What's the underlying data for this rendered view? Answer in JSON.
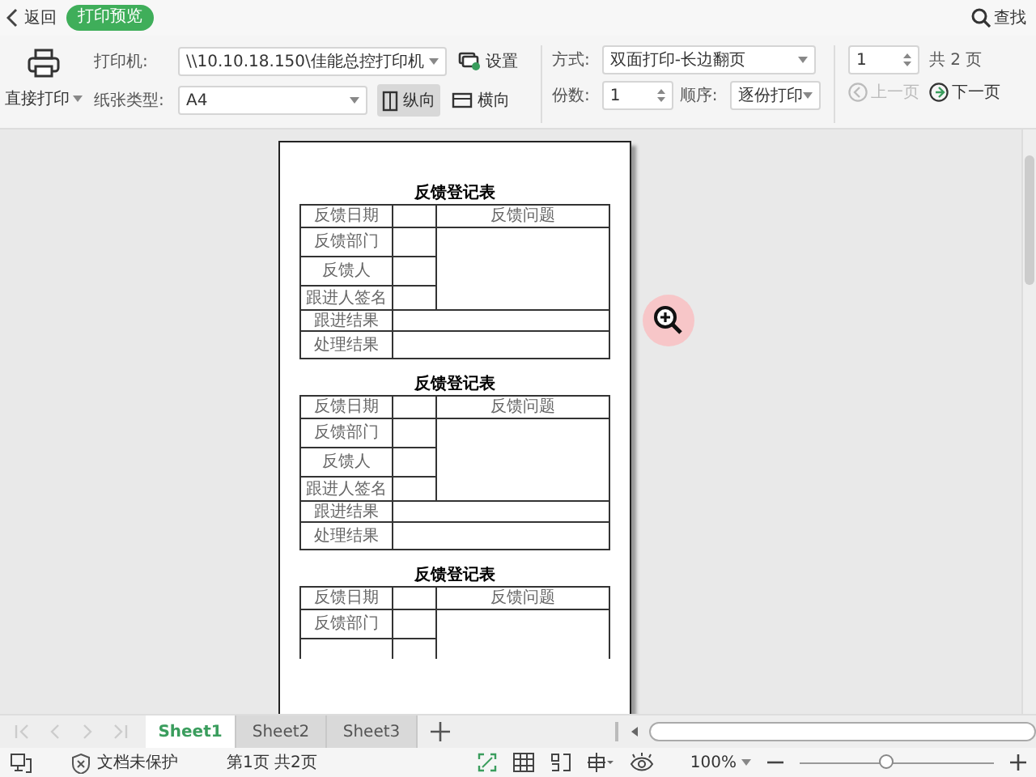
{
  "topbar": {
    "back": "返回",
    "mode": "打印预览",
    "find": "查找"
  },
  "toolbar": {
    "print_button": "直接打印",
    "printer": {
      "label": "打印机:",
      "value": "\\\\10.10.18.150\\佳能总控打印机"
    },
    "settings": "设置",
    "paper": {
      "label": "纸张类型:",
      "value": "A4"
    },
    "orientations": [
      {
        "label": "纵向",
        "selected": true
      },
      {
        "label": "横向",
        "selected": false
      }
    ],
    "duplex": {
      "label": "方式:",
      "value": "双面打印-长边翻页"
    },
    "copies": {
      "label": "份数:",
      "value": "1"
    },
    "order": {
      "label": "顺序:",
      "value": "逐份打印"
    },
    "page": {
      "value": "1",
      "total": "共 2 页"
    },
    "prev": {
      "label": "上一页",
      "disabled": true
    },
    "next": {
      "label": "下一页",
      "disabled": false
    }
  },
  "preview": {
    "forms": [
      {
        "title": "反馈登记表",
        "date_label": "反馈日期",
        "issue_label": "反馈问题",
        "rows": [
          "反馈部门",
          "反馈人",
          "跟进人签名"
        ],
        "result_rows": [
          "跟进结果",
          "处理结果"
        ],
        "cut": false
      },
      {
        "title": "反馈登记表",
        "date_label": "反馈日期",
        "issue_label": "反馈问题",
        "rows": [
          "反馈部门",
          "反馈人",
          "跟进人签名"
        ],
        "result_rows": [
          "跟进结果",
          "处理结果"
        ],
        "cut": false
      },
      {
        "title": "反馈登记表",
        "date_label": "反馈日期",
        "issue_label": "反馈问题",
        "rows": [
          "反馈部门"
        ],
        "cut": true
      }
    ]
  },
  "sheets": [
    {
      "label": "Sheet1",
      "selected": true
    },
    {
      "label": "Sheet2",
      "selected": false
    },
    {
      "label": "Sheet3",
      "selected": false
    }
  ],
  "status_bar": {
    "protection": "文档未保护",
    "page_info": "第1页 共2页",
    "zoom": "100%",
    "zoom_slider": {
      "level": 0.45
    }
  }
}
